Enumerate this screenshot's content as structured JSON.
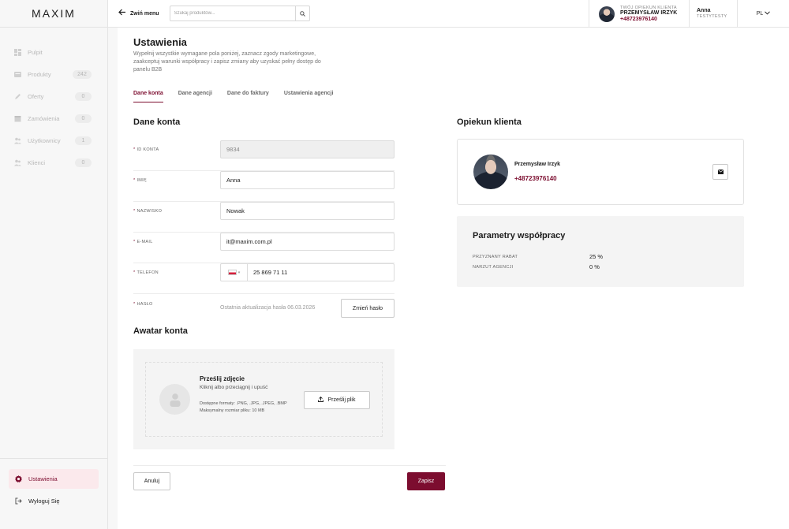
{
  "app": {
    "logo": "MAXIM"
  },
  "sidebar": {
    "items": [
      {
        "label": "Pulpit",
        "icon": "dashboard-icon",
        "count": ""
      },
      {
        "label": "Produkty",
        "icon": "products-icon",
        "count": "242"
      },
      {
        "label": "Oferty",
        "icon": "offers-icon",
        "count": "0"
      },
      {
        "label": "Zamówienia",
        "icon": "orders-icon",
        "count": "0"
      },
      {
        "label": "Użytkownicy",
        "icon": "users-icon",
        "count": "1"
      },
      {
        "label": "Klienci",
        "icon": "clients-icon",
        "count": "0"
      }
    ],
    "bottom": [
      {
        "label": "Ustawienia",
        "icon": "gear-icon",
        "active": true
      },
      {
        "label": "Wyloguj Się",
        "icon": "logout-icon",
        "active": false
      }
    ]
  },
  "topbar": {
    "collapse_label": "Zwiń menu",
    "search_placeholder": "Szukaj produktów...",
    "advisor_caption": "TWÓJ OPIEKUN KLIENTA",
    "advisor_name": "PRZEMYSŁAW IRZYK",
    "advisor_phone": "+48723976140",
    "user_name": "Anna",
    "user_company": "TESTYTESTY",
    "language": "PL"
  },
  "page": {
    "title": "Ustawienia",
    "description": "Wypełnij wszystkie wymagane pola poniżej, zaznacz zgody marketingowe, zaakceptuj warunki współpracy i zapisz zmiany aby uzyskać pełny dostęp do panelu B2B"
  },
  "tabs": [
    {
      "label": "Dane konta",
      "active": true
    },
    {
      "label": "Dane agencji",
      "active": false
    },
    {
      "label": "Dane do faktury",
      "active": false
    },
    {
      "label": "Ustawienia agencji",
      "active": false
    }
  ],
  "account": {
    "section_title": "Dane konta",
    "id_label": "ID KONTA",
    "id_value": "9834",
    "first_name_label": "IMIĘ",
    "first_name_value": "Anna",
    "last_name_label": "NAZWISKO",
    "last_name_value": "Nowak",
    "email_label": "E-MAIL",
    "email_value": "it@maxim.com.pl",
    "phone_label": "TELEFON",
    "phone_value": "25 869 71 11",
    "password_label": "HASŁO",
    "password_note": "Ostatnia aktualizacja hasła 06.03.2026",
    "password_button": "Zmień hasło"
  },
  "avatar": {
    "section_title": "Awatar konta",
    "upload_title": "Prześlij zdjęcie",
    "upload_subtitle": "Kliknij albo przeciągnij i upuść",
    "formats": "Dostępne formaty: .PNG, .JPG, .JPEG, .BMP",
    "max_size": "Maksymalny rozmiar pliku: 10 MB",
    "upload_button": "Prześlij plik"
  },
  "actions": {
    "cancel": "Anuluj",
    "save": "Zapisz"
  },
  "advisor": {
    "section_title": "Opiekun klienta",
    "name": "Przemysław Irzyk",
    "phone": "+48723976140"
  },
  "cooperation": {
    "title": "Parametry współpracy",
    "discount_label": "PRZYZNANY RABAT",
    "discount_value": "25 %",
    "markup_label": "NARZUT AGENCJI",
    "markup_value": "0 %"
  },
  "colors": {
    "accent": "#7c0d2f",
    "accent_light": "#fbe9ec"
  }
}
